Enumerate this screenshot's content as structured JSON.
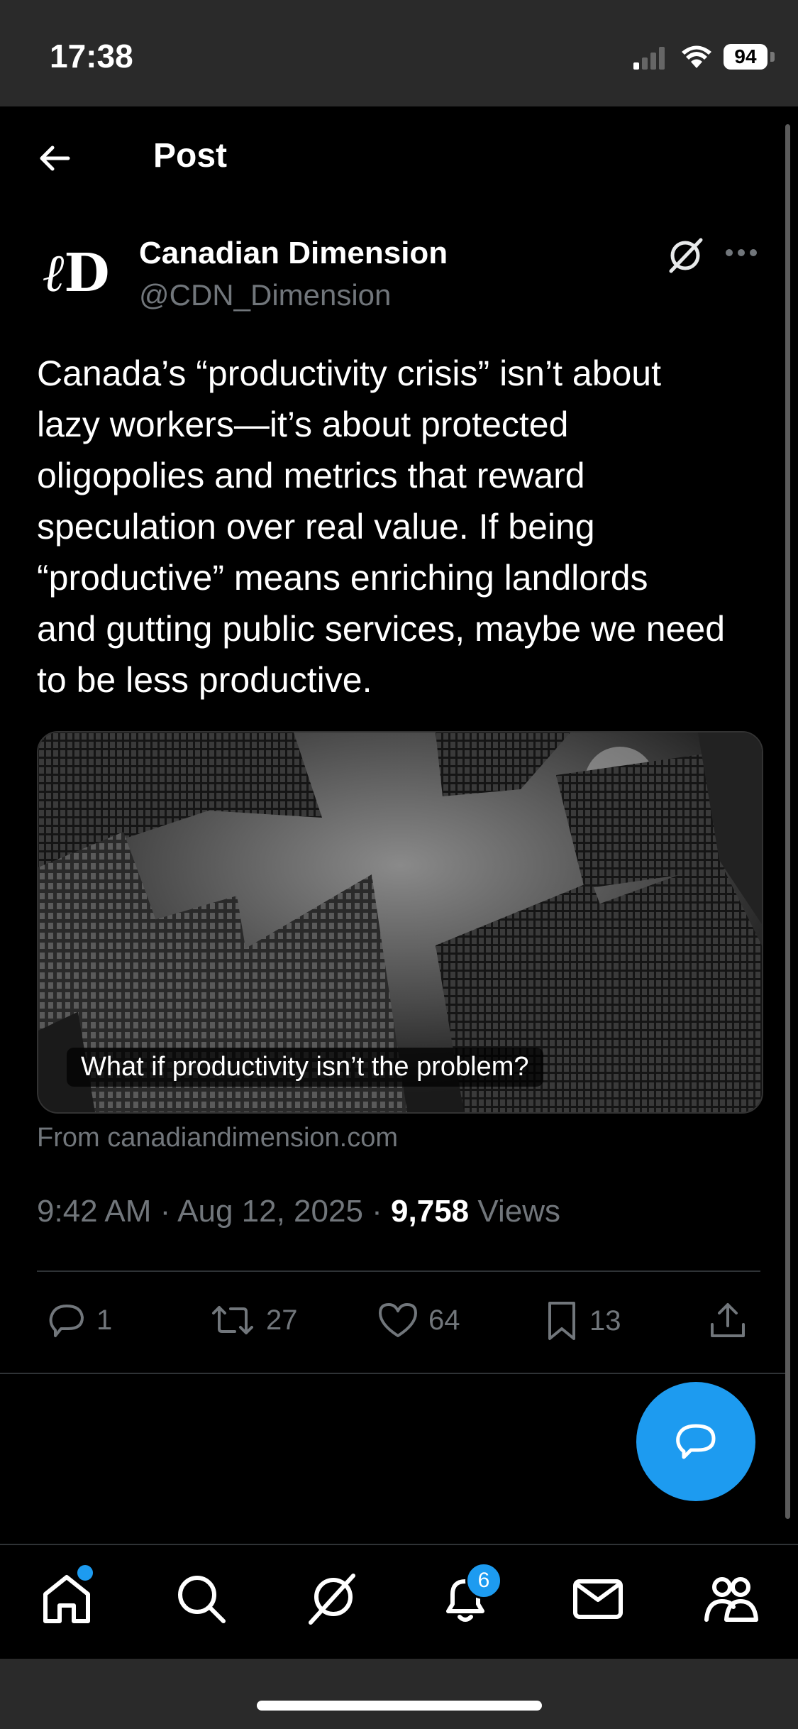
{
  "status_bar": {
    "time": "17:38",
    "battery": "94"
  },
  "header": {
    "title": "Post"
  },
  "author": {
    "name": "Canadian Dimension",
    "handle": "@CDN_Dimension"
  },
  "post": {
    "text": "Canada’s “productivity crisis” isn’t about\nlazy workers—it’s about protected\noligopolies and metrics that reward\nspeculation over real value. If being\n“productive” means enriching landlords\nand gutting public services, maybe we need\nto be less productive."
  },
  "card": {
    "caption": "What if productivity isn’t the problem?",
    "source": "From canadiandimension.com"
  },
  "meta": {
    "time": "9:42 AM",
    "date": "Aug 12, 2025",
    "views_count": "9,758",
    "views_label": "Views",
    "separator": "·"
  },
  "actions": {
    "replies": "1",
    "reposts": "27",
    "likes": "64",
    "bookmarks": "13"
  },
  "bottom_nav": {
    "notifications_badge": "6"
  },
  "colors": {
    "accent": "#1d9bf0",
    "background": "#000000",
    "muted": "#71767b"
  }
}
